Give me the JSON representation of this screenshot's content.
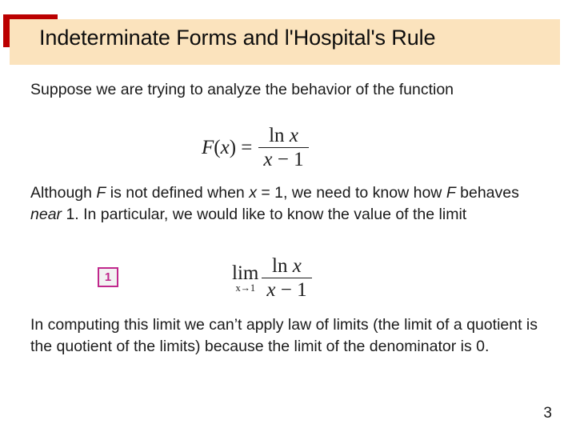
{
  "slide": {
    "title": "Indeterminate Forms and l'Hospital's Rule",
    "page_number": "3",
    "accent_color": "#bb0000",
    "banner_color": "#fbe3bd",
    "eq_tag_color": "#c0288c",
    "background_color": "#ffffff"
  },
  "paragraphs": {
    "p1_part1": "Suppose we are trying to analyze the behavior of the function",
    "p2_part1": "Although ",
    "p2_italic1": "F",
    "p2_part2": " is not defined when ",
    "p2_italic2": "x",
    "p2_part3": " = 1, we need to know how ",
    "p2_italic3": "F",
    "p2_part4": " behaves ",
    "p2_italic4": "near",
    "p2_part5": " 1. In particular, we would like to know the value of the limit",
    "p3_part1": "In computing this limit we can’t apply law of limits (the limit of a quotient is the quotient of the limits) because the limit of the denominator is 0."
  },
  "formula_function": {
    "lhs_f": "F",
    "lhs_open": "(",
    "lhs_var": "x",
    "lhs_close": ")",
    "equals": "=",
    "numerator_ln": "ln",
    "numerator_var": "x",
    "denominator_var": "x",
    "denominator_minus": "−",
    "denominator_one": "1"
  },
  "formula_limit": {
    "tag": "1",
    "operator": "lim",
    "subscript": "x→1",
    "numerator_ln": "ln",
    "numerator_var": "x",
    "denominator_var": "x",
    "denominator_minus": "−",
    "denominator_one": "1"
  }
}
